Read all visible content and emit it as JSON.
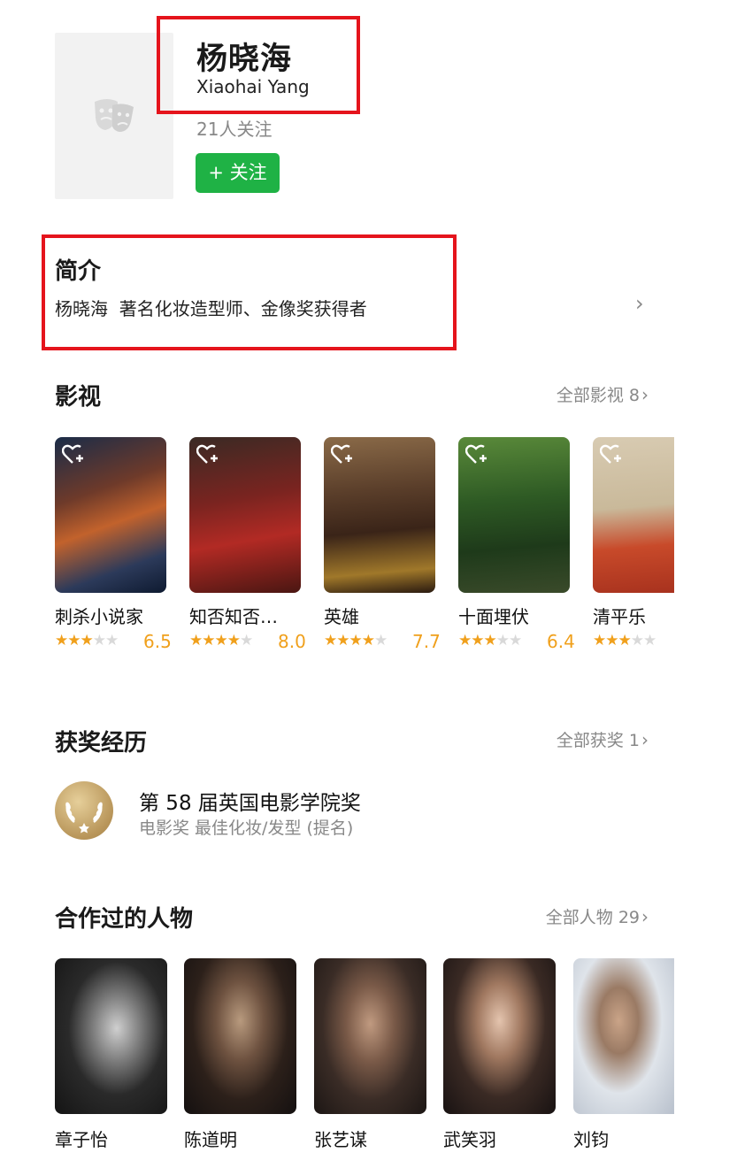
{
  "profile": {
    "name_cn": "杨晓海",
    "name_en": "Xiaohai Yang",
    "followers": "21人关注",
    "follow_label": "+ 关注"
  },
  "intro": {
    "title": "简介",
    "text": "杨晓海  著名化妆造型师、金像奖获得者"
  },
  "films": {
    "title": "影视",
    "all_label": "全部影视 8",
    "items": [
      {
        "title": "刺杀小说家",
        "stars": 3,
        "score": "6.5"
      },
      {
        "title": "知否知否…",
        "stars": 4,
        "score": "8.0"
      },
      {
        "title": "英雄",
        "stars": 4,
        "score": "7.7"
      },
      {
        "title": "十面埋伏",
        "stars": 3,
        "score": "6.4"
      },
      {
        "title": "清平乐",
        "stars": 3,
        "score": ""
      }
    ]
  },
  "awards": {
    "title": "获奖经历",
    "all_label": "全部获奖 1",
    "items": [
      {
        "name": "第 58 届英国电影学院奖",
        "category": "电影奖 最佳化妆/发型 (提名)"
      }
    ]
  },
  "people": {
    "title": "合作过的人物",
    "all_label": "全部人物 29",
    "items": [
      {
        "name": "章子怡"
      },
      {
        "name": "陈道明"
      },
      {
        "name": "张艺谋"
      },
      {
        "name": "武笑羽"
      },
      {
        "name": "刘钧"
      }
    ]
  },
  "colors": {
    "accent_green": "#1fb245",
    "star_orange": "#f0a01c",
    "highlight_red": "#e5141c"
  }
}
